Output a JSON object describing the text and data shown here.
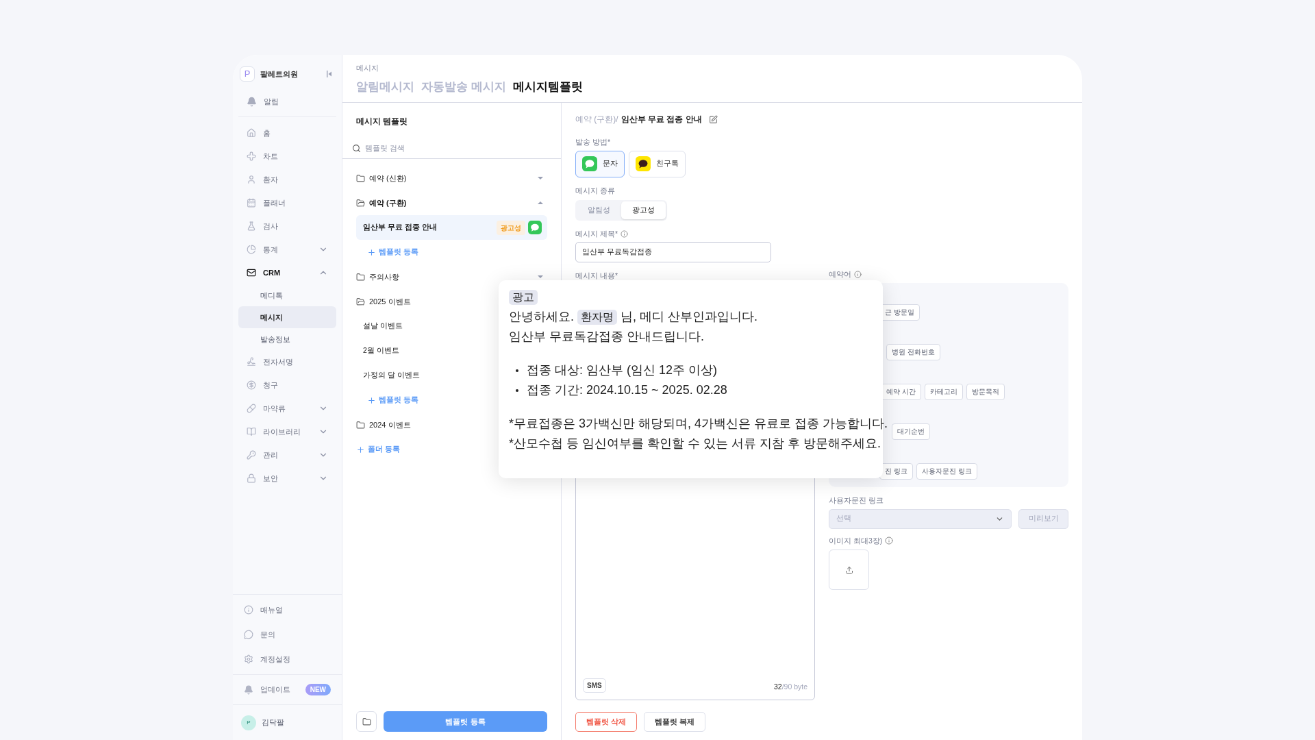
{
  "sidebar": {
    "brand": {
      "logo": "P",
      "name": "팔레트의원"
    },
    "alert": {
      "label": "알림"
    },
    "nav": [
      {
        "label": "홈",
        "kind": "link"
      },
      {
        "label": "차트",
        "kind": "link"
      },
      {
        "label": "환자",
        "kind": "link"
      },
      {
        "label": "플래너",
        "kind": "link"
      },
      {
        "label": "검사",
        "kind": "link"
      },
      {
        "label": "통계",
        "kind": "group",
        "expanded": false
      },
      {
        "label": "CRM",
        "kind": "group",
        "expanded": true,
        "children": [
          {
            "label": "메디톡",
            "selected": false
          },
          {
            "label": "메시지",
            "selected": true
          },
          {
            "label": "발송정보",
            "selected": false
          }
        ]
      },
      {
        "label": "전자서명",
        "kind": "link"
      },
      {
        "label": "청구",
        "kind": "link"
      },
      {
        "label": "마약류",
        "kind": "group",
        "expanded": false
      },
      {
        "label": "라이브러리",
        "kind": "group",
        "expanded": false
      },
      {
        "label": "관리",
        "kind": "group",
        "expanded": false
      },
      {
        "label": "보안",
        "kind": "group",
        "expanded": false
      }
    ],
    "footer": [
      {
        "label": "매뉴얼"
      },
      {
        "label": "문의"
      },
      {
        "label": "계정설정"
      }
    ],
    "update": {
      "label": "업데이트",
      "badge": "NEW"
    },
    "user": {
      "initial": "P",
      "name": "김닥팔"
    }
  },
  "header": {
    "breadcrumb": "메시지",
    "tabs": [
      {
        "label": "알림메시지",
        "selected": false
      },
      {
        "label": "자동발송 메시지",
        "selected": false
      },
      {
        "label": "메시지템플릿",
        "selected": true
      }
    ]
  },
  "templates": {
    "title": "메시지 템플릿",
    "search": {
      "placeholder": "템플릿 검색"
    },
    "folders": [
      {
        "name": "예약 (신환)",
        "expanded": false,
        "toggle": true
      },
      {
        "name": "예약 (구환)",
        "expanded": true,
        "toggle": true,
        "items": [
          {
            "name": "임산부 무료 접종 안내",
            "selected": true,
            "tag": "광고성"
          }
        ],
        "add_label": "템플릿 등록"
      },
      {
        "name": "주의사항",
        "expanded": false,
        "toggle": true
      },
      {
        "name": "2025 이벤트",
        "expanded": true,
        "items": [
          {
            "name": "설날 이벤트",
            "selected": false
          },
          {
            "name": "2월 이벤트",
            "selected": false
          },
          {
            "name": "가정의 달 이벤트",
            "selected": false
          }
        ],
        "add_label": "템플릿 등록"
      },
      {
        "name": "2024 이벤트",
        "expanded": false
      }
    ],
    "add_folder": "폴더 등록",
    "register_button": "템플릿 등록"
  },
  "editor": {
    "path": "예약 (구환)/",
    "title": "임산부 무료 접종 안내",
    "method_label": "발송 방법*",
    "methods": [
      {
        "label": "문자",
        "kind": "sms",
        "selected": true
      },
      {
        "label": "친구톡",
        "kind": "kakao",
        "selected": false
      }
    ],
    "type_label": "메시지 종류",
    "types": [
      {
        "label": "알림성",
        "selected": false
      },
      {
        "label": "광고성",
        "selected": true
      }
    ],
    "title_label": "메시지 제목*",
    "title_value": "임산부 무료독감접종",
    "content_label": "메시지 내용*",
    "sms_badge": "SMS",
    "byte_count": "32",
    "byte_limit": "/90 byte",
    "variables_label": "예약어",
    "variable_rows": [
      [
        "근 방문일"
      ],
      [
        "병원 전화번호"
      ],
      [
        "예약 시간",
        "카테고리",
        "방문목적"
      ],
      [
        "대기순번"
      ],
      [
        "진 링크",
        "사용자문진 링크"
      ]
    ],
    "survey_label": "사용자문진 링크",
    "survey_select": {
      "placeholder": "선택"
    },
    "preview_button": {
      "label": "미리보기",
      "disabled": true
    },
    "image_label": "이미지 최대3장)",
    "delete_button": "템플릿 삭제",
    "copy_button": "템플릿 복제"
  },
  "preview": {
    "tag": "광고",
    "lines": [
      {
        "kind": "variable",
        "before": "안녕하세요.",
        "variable": "환자명",
        "after": "님, 메디 산부인과입니다."
      },
      {
        "kind": "text",
        "text": "임산부 무료독감접종 안내드립니다."
      },
      {
        "kind": "blank"
      },
      {
        "kind": "bullet",
        "text": "접종 대상: 임산부 (임신 12주 이상)"
      },
      {
        "kind": "bullet",
        "text": "접종 기간: 2024.10.15 ~ 2025. 02.28"
      },
      {
        "kind": "blank"
      },
      {
        "kind": "text",
        "text": "*무료접종은 3가백신만 해당되며, 4가백신은 유료로 접종 가능합니다."
      },
      {
        "kind": "text",
        "text": "*산모수첩 등 임신여부를 확인할 수 있는 서류 지참 후 방문해주세요."
      }
    ]
  }
}
